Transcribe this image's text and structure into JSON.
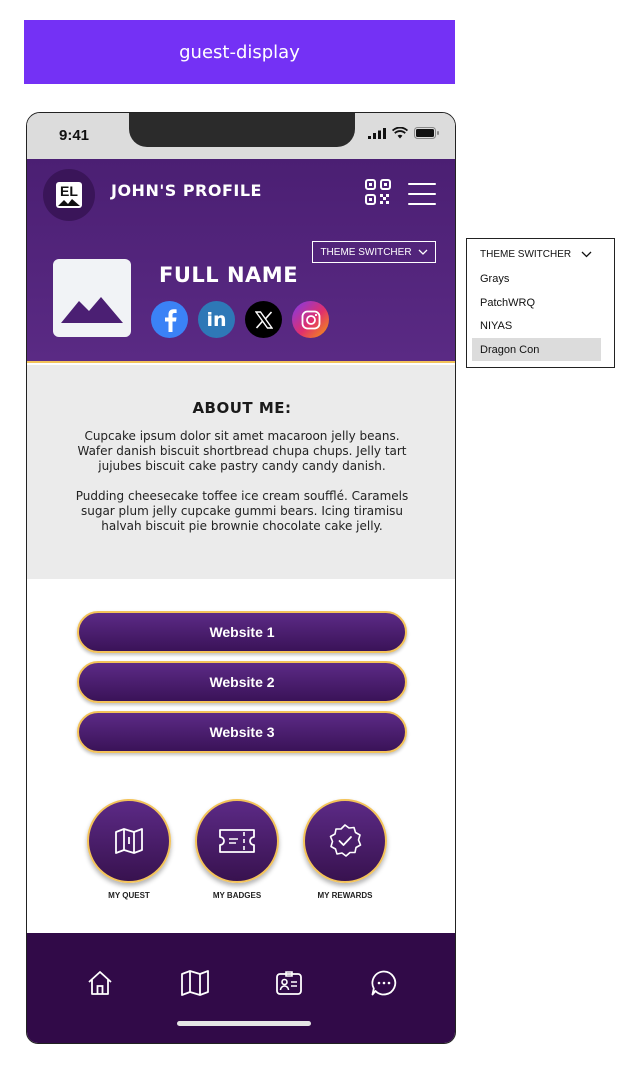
{
  "banner": {
    "label": "guest-display"
  },
  "status": {
    "time": "9:41"
  },
  "header": {
    "logo_text": "EL",
    "title": "JOHN'S PROFILE",
    "theme_switcher_label": "THEME SWITCHER"
  },
  "profile": {
    "full_name": "FULL NAME",
    "socials": [
      "facebook",
      "linkedin",
      "x",
      "instagram"
    ]
  },
  "about": {
    "title": "ABOUT ME:",
    "paragraph1": "Cupcake ipsum dolor sit amet macaroon jelly beans. Wafer danish biscuit shortbread chupa chups. Jelly tart jujubes biscuit cake pastry candy candy danish.",
    "paragraph2": "Pudding cheesecake toffee ice cream soufflé. Caramels sugar plum jelly cupcake gummi bears. Icing tiramisu halvah biscuit pie brownie chocolate cake jelly."
  },
  "links": [
    "Website 1",
    "Website 2",
    "Website 3"
  ],
  "features": [
    {
      "label": "MY QUEST",
      "icon": "map-icon"
    },
    {
      "label": "MY BADGES",
      "icon": "ticket-icon"
    },
    {
      "label": "MY REWARDS",
      "icon": "badge-check-icon"
    }
  ],
  "bottom_nav": [
    "home-icon",
    "map-icon",
    "id-card-icon",
    "chat-icon"
  ],
  "dropdown": {
    "label": "THEME SWITCHER",
    "options": [
      "Grays",
      "PatchWRQ",
      "NIYAS",
      "Dragon Con"
    ],
    "selected": "Dragon Con"
  },
  "colors": {
    "banner": "#7431f5",
    "brand_purple": "#4b1f73",
    "nav_dark": "#310a48",
    "accent_gold": "#f3c35a",
    "about_bg": "#ebebeb"
  }
}
